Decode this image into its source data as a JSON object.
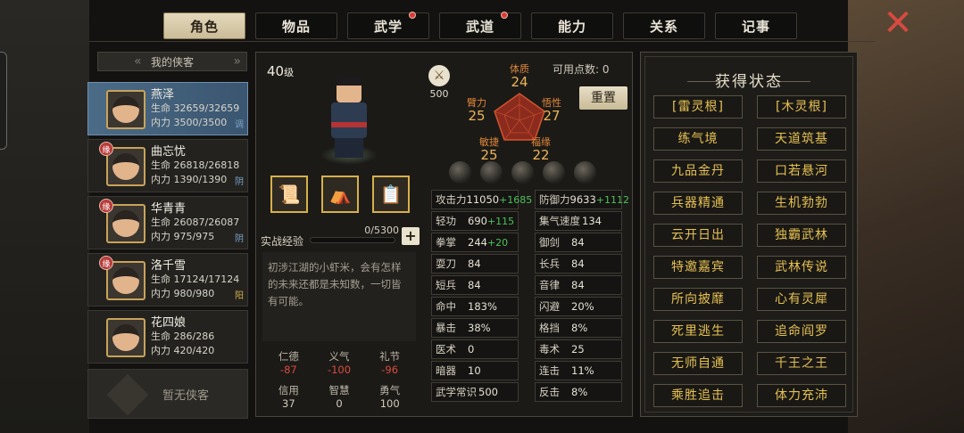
{
  "tabs": [
    {
      "label": "角色",
      "active": true,
      "dot": false
    },
    {
      "label": "物品",
      "active": false,
      "dot": false
    },
    {
      "label": "武学",
      "active": false,
      "dot": true
    },
    {
      "label": "武道",
      "active": false,
      "dot": true
    },
    {
      "label": "能力",
      "active": false,
      "dot": false
    },
    {
      "label": "关系",
      "active": false,
      "dot": false
    },
    {
      "label": "记事",
      "active": false,
      "dot": false
    }
  ],
  "list": {
    "title": "我的侠客",
    "empty": "暂无侠客",
    "characters": [
      {
        "name": "燕泽",
        "hp": "生命 32659/32659",
        "mp": "内力 3500/3500",
        "badge": "调",
        "tag": ""
      },
      {
        "name": "曲忘忧",
        "hp": "生命 26818/26818",
        "mp": "内力 1390/1390",
        "badge": "阴",
        "tag": "缘"
      },
      {
        "name": "华青青",
        "hp": "生命 26087/26087",
        "mp": "内力 975/975",
        "badge": "阴",
        "tag": "缘"
      },
      {
        "name": "洛千雪",
        "hp": "生命 17124/17124",
        "mp": "内力 980/980",
        "badge": "阳",
        "tag": "缘"
      },
      {
        "name": "花四娘",
        "hp": "生命 286/286",
        "mp": "内力 420/420",
        "badge": "",
        "tag": ""
      }
    ]
  },
  "hero": {
    "level": "40",
    "level_unit": "级",
    "exp_label": "实战经验",
    "exp_value": "0/5300",
    "exp_fraction": 0,
    "description": "初涉江湖的小虾米，会有怎样的未来还都是未知数，一切皆有可能。",
    "virtues": [
      {
        "k": "仁德",
        "v": "-87",
        "neg": true
      },
      {
        "k": "义气",
        "v": "-100",
        "neg": true
      },
      {
        "k": "礼节",
        "v": "-96",
        "neg": true
      },
      {
        "k": "信用",
        "v": "37",
        "neg": false
      },
      {
        "k": "智慧",
        "v": "0",
        "neg": false
      },
      {
        "k": "勇气",
        "v": "100",
        "neg": false
      }
    ]
  },
  "attributes": {
    "awaken_value": "500",
    "points_label": "可用点数: 0",
    "reset_label": "重置",
    "items": [
      {
        "k": "体质",
        "v": "24"
      },
      {
        "k": "臂力",
        "v": "25"
      },
      {
        "k": "悟性",
        "v": "27"
      },
      {
        "k": "敏捷",
        "v": "25"
      },
      {
        "k": "福缘",
        "v": "22"
      }
    ]
  },
  "stats": [
    {
      "k": "攻击力",
      "v": "11050",
      "g": "+1685"
    },
    {
      "k": "防御力",
      "v": "9633",
      "g": "+1112"
    },
    {
      "k": "轻功",
      "v": "690",
      "g": "+115"
    },
    {
      "k": "集气速度",
      "v": "134",
      "g": ""
    },
    {
      "k": "拳掌",
      "v": "244",
      "g": "+20"
    },
    {
      "k": "御剑",
      "v": "84",
      "g": ""
    },
    {
      "k": "耍刀",
      "v": "84",
      "g": ""
    },
    {
      "k": "长兵",
      "v": "84",
      "g": ""
    },
    {
      "k": "短兵",
      "v": "84",
      "g": ""
    },
    {
      "k": "音律",
      "v": "84",
      "g": ""
    },
    {
      "k": "命中",
      "v": "183%",
      "g": ""
    },
    {
      "k": "闪避",
      "v": "20%",
      "g": ""
    },
    {
      "k": "暴击",
      "v": "38%",
      "g": ""
    },
    {
      "k": "格挡",
      "v": "8%",
      "g": ""
    },
    {
      "k": "医术",
      "v": "0",
      "g": ""
    },
    {
      "k": "毒术",
      "v": "25",
      "g": ""
    },
    {
      "k": "暗器",
      "v": "10",
      "g": ""
    },
    {
      "k": "连击",
      "v": "11%",
      "g": ""
    },
    {
      "k": "武学常识",
      "v": "500",
      "g": ""
    },
    {
      "k": "反击",
      "v": "8%",
      "g": ""
    }
  ],
  "status_panel": {
    "title": "获得状态",
    "items": [
      "[雷灵根]",
      "[木灵根]",
      "练气境",
      "天道筑基",
      "九品金丹",
      "口若悬河",
      "兵器精通",
      "生机勃勃",
      "云开日出",
      "独霸武林",
      "特邀嘉宾",
      "武林传说",
      "所向披靡",
      "心有灵犀",
      "死里逃生",
      "追命阎罗",
      "无师自通",
      "千王之王",
      "乘胜追击",
      "体力充沛"
    ]
  }
}
